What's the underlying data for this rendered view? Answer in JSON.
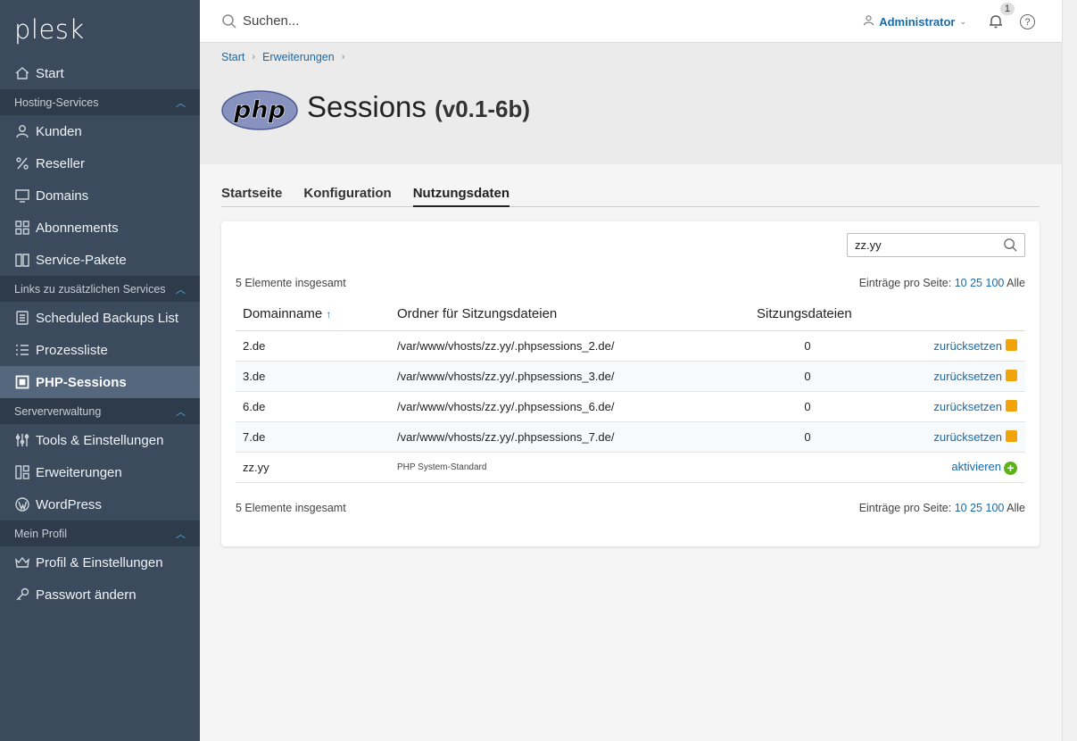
{
  "brand": {
    "logo": "plesk"
  },
  "sidebar": {
    "start": "Start",
    "sections": [
      {
        "label": "Hosting-Services",
        "items": [
          "Kunden",
          "Reseller",
          "Domains",
          "Abonnements",
          "Service-Pakete"
        ]
      },
      {
        "label": "Links zu zusätzlichen Services",
        "items": [
          "Scheduled Backups List",
          "Prozessliste",
          "PHP-Sessions"
        ]
      },
      {
        "label": "Serververwaltung",
        "items": [
          "Tools & Einstellungen",
          "Erweiterungen",
          "WordPress"
        ]
      },
      {
        "label": "Mein Profil",
        "items": [
          "Profil & Einstellungen",
          "Passwort ändern"
        ]
      }
    ],
    "active_item": "PHP-Sessions"
  },
  "topbar": {
    "search_placeholder": "Suchen...",
    "user": "Administrator",
    "notification_count": "1",
    "help": "?"
  },
  "breadcrumb": [
    "Start",
    "Erweiterungen"
  ],
  "page": {
    "logo_text": "php",
    "title": "Sessions",
    "version": "(v0.1-6b)"
  },
  "tabs": [
    "Startseite",
    "Konfiguration",
    "Nutzungsdaten"
  ],
  "active_tab": "Nutzungsdaten",
  "list": {
    "filter_value": "zz.yy",
    "total_label": "5 Elemente insgesamt",
    "per_page_label": "Einträge pro Seite:",
    "per_page_options": [
      "10",
      "25",
      "100"
    ],
    "per_page_all": "Alle",
    "columns": [
      "Domainname",
      "Ordner für Sitzungsdateien",
      "Sitzungsdateien"
    ],
    "sort_arrow": "↑",
    "rows": [
      {
        "domain": "2.de",
        "folder": "/var/www/vhosts/zz.yy/.phpsessions_2.de/",
        "count": "0",
        "action": "zurücksetzen"
      },
      {
        "domain": "3.de",
        "folder": "/var/www/vhosts/zz.yy/.phpsessions_3.de/",
        "count": "0",
        "action": "zurücksetzen"
      },
      {
        "domain": "6.de",
        "folder": "/var/www/vhosts/zz.yy/.phpsessions_6.de/",
        "count": "0",
        "action": "zurücksetzen"
      },
      {
        "domain": "7.de",
        "folder": "/var/www/vhosts/zz.yy/.phpsessions_7.de/",
        "count": "0",
        "action": "zurücksetzen"
      },
      {
        "domain": "zz.yy",
        "folder": "PHP System-Standard",
        "count": "",
        "action": "aktivieren"
      }
    ]
  },
  "colors": {
    "sidebar_bg": "#3b4a5c",
    "section_bg": "#2e3b4b",
    "active_bg": "#54677d",
    "link": "#1a6aa9",
    "reset_icon": "#f0a30a",
    "add_icon": "#5bb318"
  }
}
